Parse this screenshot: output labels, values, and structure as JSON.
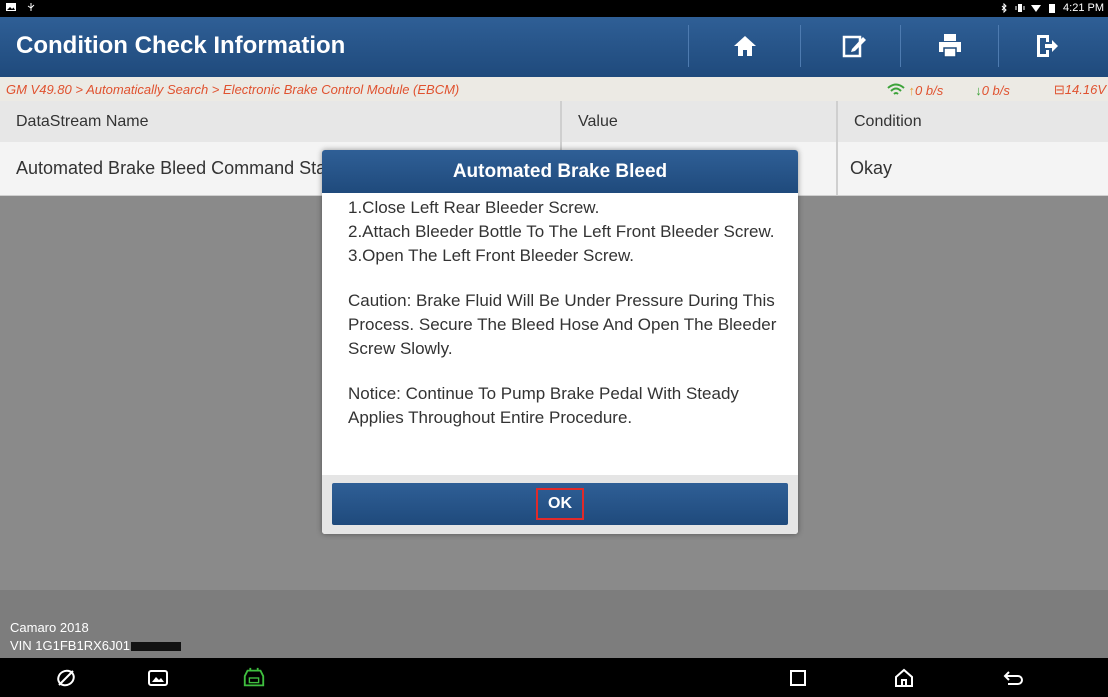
{
  "status_bar": {
    "time": "4:21 PM"
  },
  "header": {
    "title": "Condition Check Information",
    "buttons": [
      "home-icon",
      "edit-icon",
      "print-icon",
      "exit-icon"
    ]
  },
  "breadcrumb": {
    "path": "GM V49.80 > Automatically Search > Electronic Brake Control Module (EBCM)",
    "upload_rate": "0 b/s",
    "download_rate": "0 b/s",
    "voltage": "14.16V"
  },
  "table": {
    "headers": {
      "name": "DataStream Name",
      "value": "Value",
      "condition": "Condition"
    },
    "rows": [
      {
        "name": "Automated Brake Bleed Command Status",
        "value": "",
        "condition": "Okay"
      }
    ]
  },
  "footer": {
    "vehicle": "Camaro 2018",
    "vin": "VIN 1G1FB1RX6J01"
  },
  "dialog": {
    "title": "Automated Brake Bleed",
    "steps": [
      "1.Close Left Rear Bleeder Screw.",
      "2.Attach Bleeder Bottle To The Left Front Bleeder Screw.",
      "3.Open The Left Front Bleeder Screw."
    ],
    "caution": "Caution: Brake Fluid Will Be Under Pressure During This Process. Secure The Bleed Hose And Open The Bleeder Screw Slowly.",
    "notice": "Notice: Continue To Pump Brake Pedal With Steady Applies Throughout Entire Procedure.",
    "ok_label": "OK"
  },
  "colors": {
    "accent": "#2a578c",
    "breadcrumb_text": "#e0522f",
    "highlight": "#e02a2a"
  }
}
